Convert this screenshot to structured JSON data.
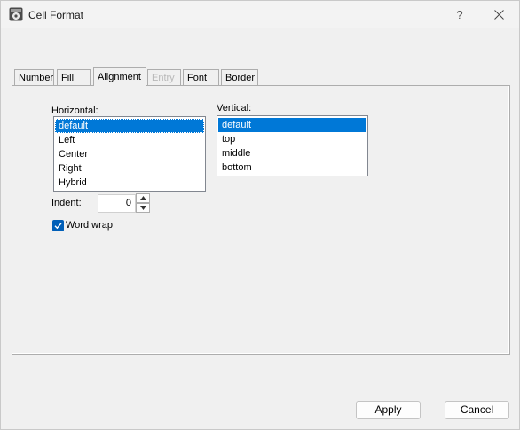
{
  "window": {
    "title": "Cell Format",
    "help": "?"
  },
  "tabs": [
    {
      "label": "Number",
      "active": false,
      "disabled": false
    },
    {
      "label": "Fill",
      "active": false,
      "disabled": false
    },
    {
      "label": "Alignment",
      "active": true,
      "disabled": false
    },
    {
      "label": "Entry",
      "active": false,
      "disabled": true
    },
    {
      "label": "Font",
      "active": false,
      "disabled": false
    },
    {
      "label": "Border",
      "active": false,
      "disabled": false
    }
  ],
  "alignment": {
    "horizontal_label": "Horizontal:",
    "horizontal_options": [
      "default",
      "Left",
      "Center",
      "Right",
      "Hybrid"
    ],
    "horizontal_selected": "default",
    "vertical_label": "Vertical:",
    "vertical_options": [
      "default",
      "top",
      "middle",
      "bottom"
    ],
    "vertical_selected": "default",
    "indent_label": "Indent:",
    "indent_value": "0",
    "word_wrap_label": "Word wrap",
    "word_wrap_checked": true
  },
  "buttons": {
    "apply": "Apply",
    "cancel": "Cancel"
  },
  "colors": {
    "selection": "#0078d7",
    "checkbox": "#005fb8"
  }
}
